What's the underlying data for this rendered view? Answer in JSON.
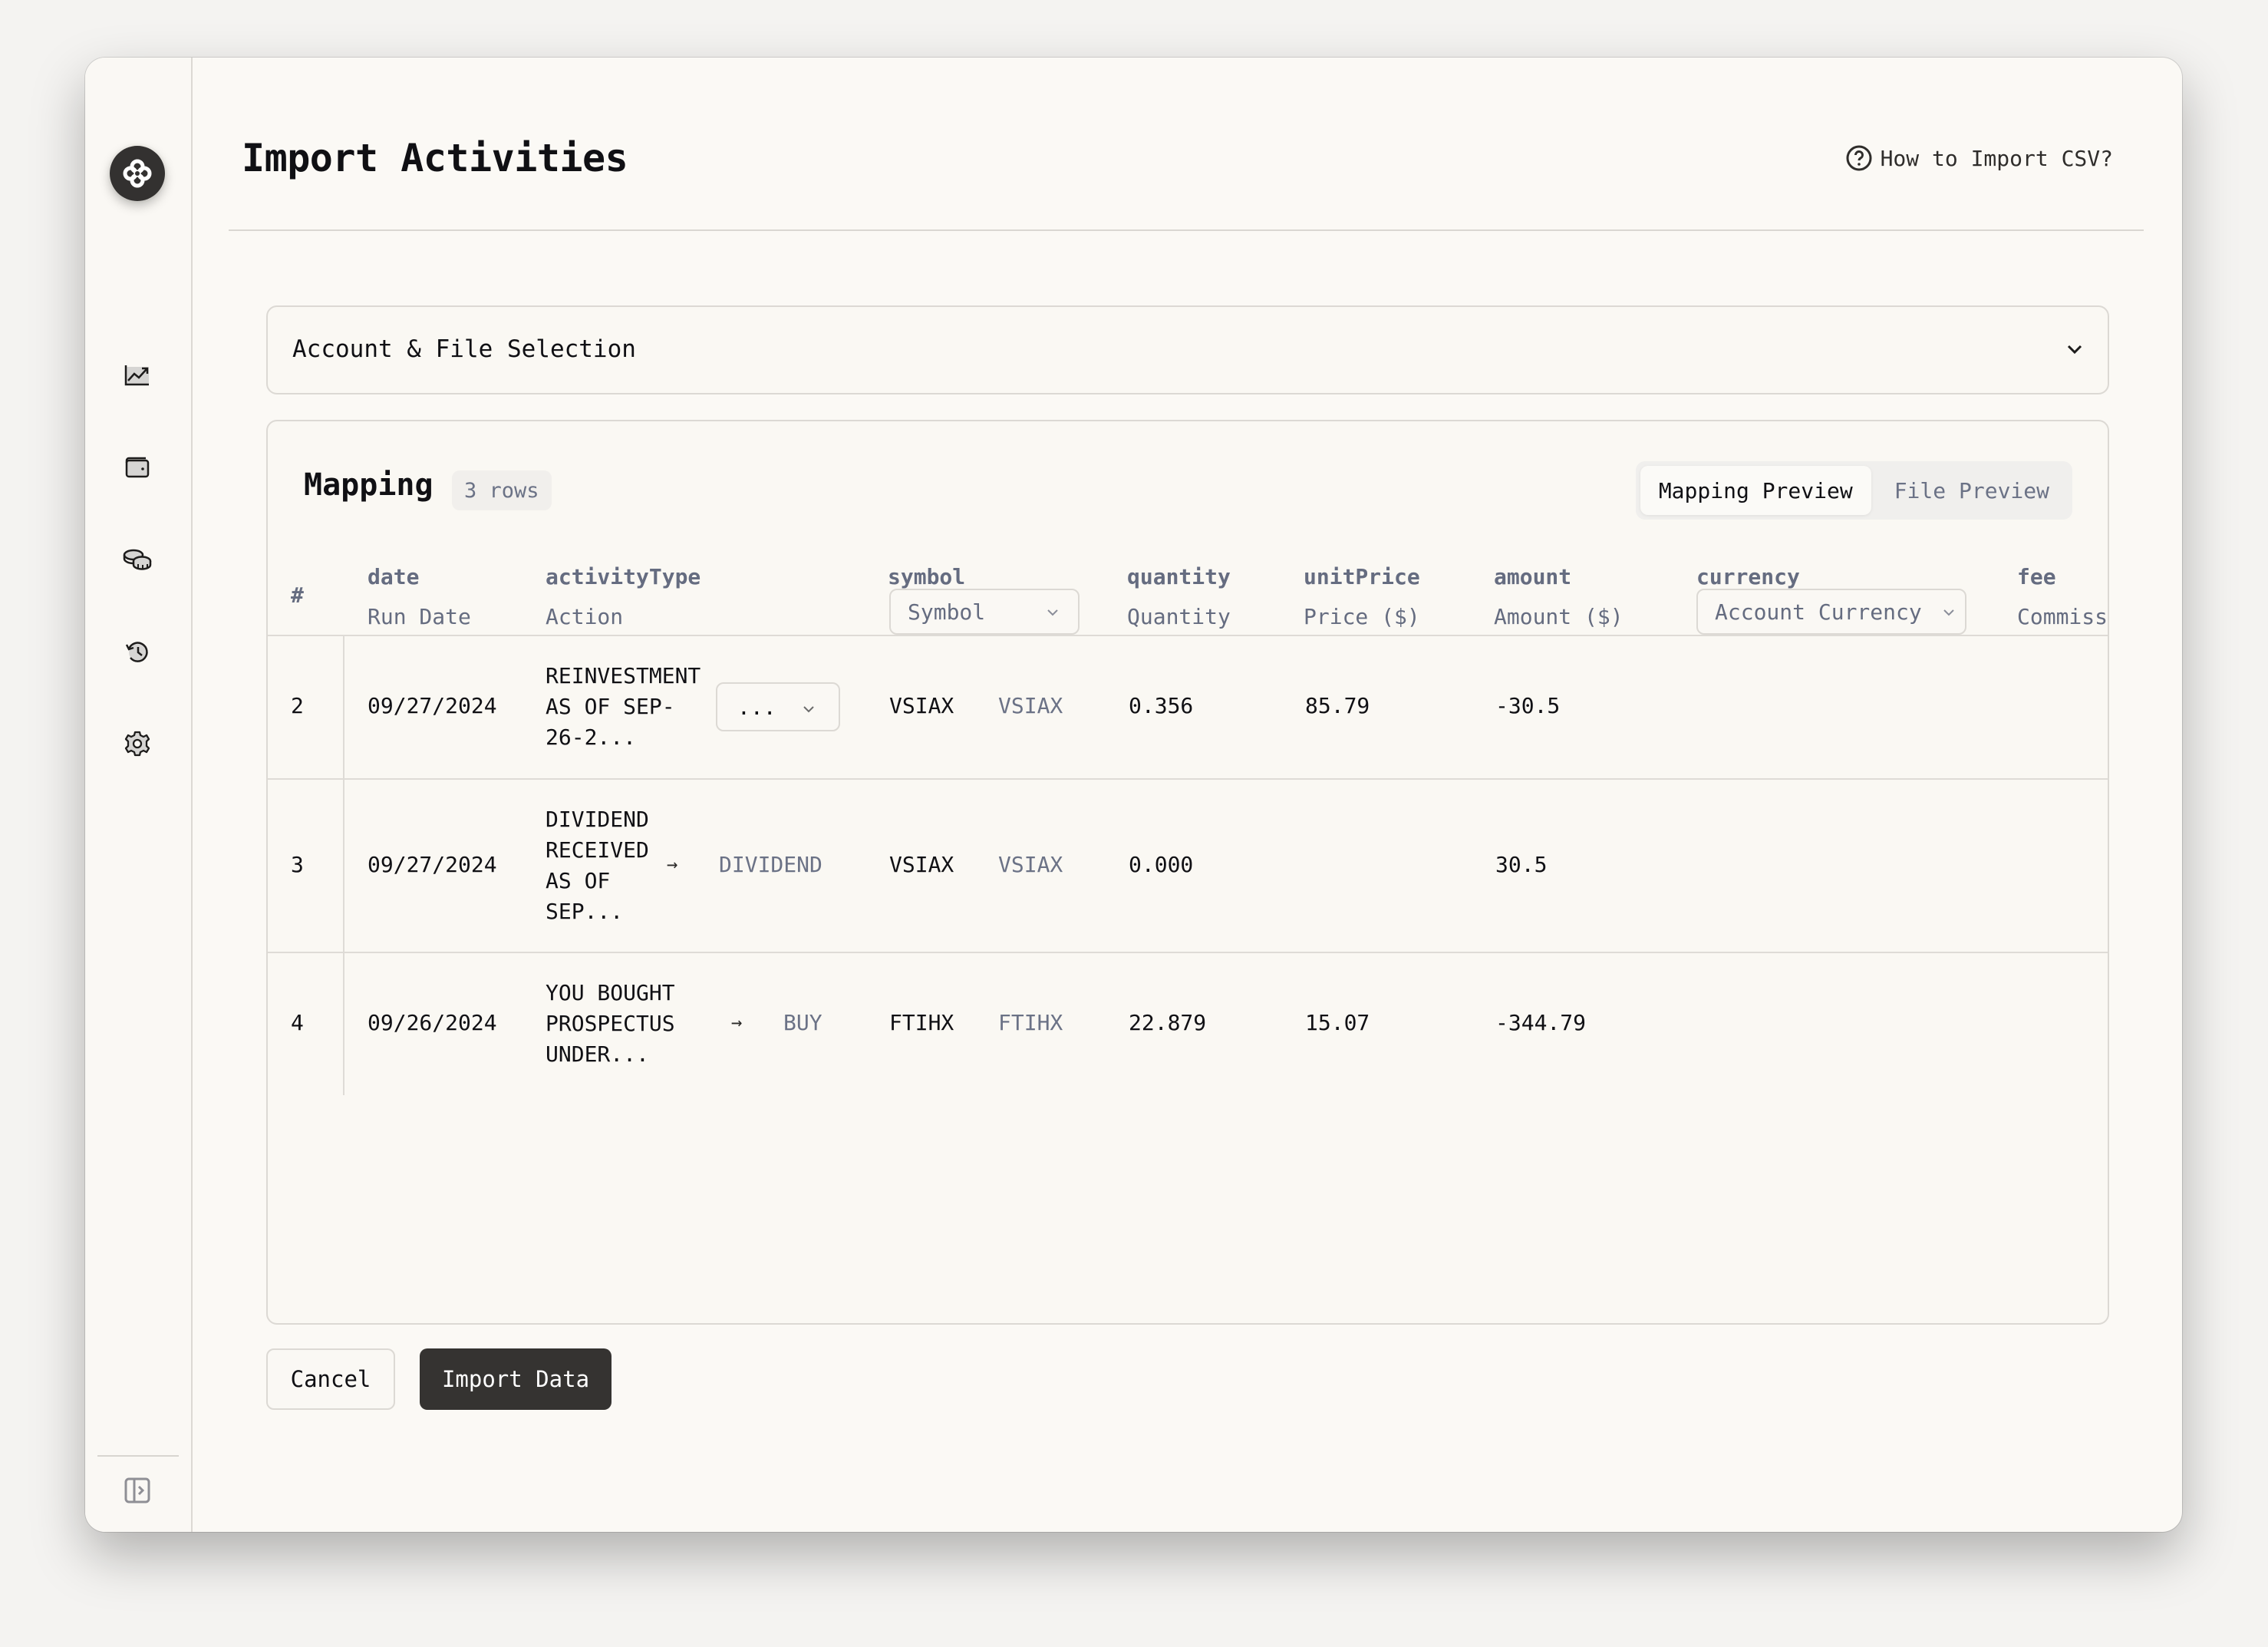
{
  "window": {
    "traffic_lights": [
      "close",
      "minimize",
      "zoom"
    ]
  },
  "sidebar": {
    "logo": "logo-icon",
    "items": [
      {
        "id": "dashboard",
        "icon": "chart-line-icon"
      },
      {
        "id": "accounts",
        "icon": "wallet-icon"
      },
      {
        "id": "holdings",
        "icon": "coins-icon"
      },
      {
        "id": "activities",
        "icon": "history-icon"
      },
      {
        "id": "settings",
        "icon": "gear-icon"
      }
    ],
    "collapse_icon": "sidebar-expand-icon"
  },
  "header": {
    "title": "Import Activities",
    "help_link": "How to Import CSV?"
  },
  "account_section": {
    "title": "Account & File Selection"
  },
  "mapping": {
    "title": "Mapping",
    "rows_badge": "3 rows",
    "tabs": [
      {
        "label": "Mapping Preview",
        "active": true
      },
      {
        "label": "File Preview",
        "active": false
      }
    ],
    "columns": {
      "index": "#",
      "date": {
        "field": "date",
        "source": "Run Date"
      },
      "activityType": {
        "field": "activityType",
        "source": "Action"
      },
      "symbol": {
        "field": "symbol",
        "source": "Symbol"
      },
      "quantity": {
        "field": "quantity",
        "source": "Quantity"
      },
      "unitPrice": {
        "field": "unitPrice",
        "source": "Price ($)"
      },
      "amount": {
        "field": "amount",
        "source": "Amount ($)"
      },
      "currency": {
        "field": "currency",
        "source": "Account Currency"
      },
      "fee": {
        "field": "fee",
        "source": "Commiss"
      }
    },
    "rows": [
      {
        "index": "2",
        "date": "09/27/2024",
        "action": "REINVESTMENT\nAS OF SEP-\n26-2...",
        "action_status": "unmapped",
        "mapped_type": "...",
        "symbol_raw": "VSIAX",
        "symbol_mapped": "VSIAX",
        "quantity": "0.356",
        "unit_price": "85.79",
        "amount": "-30.5"
      },
      {
        "index": "3",
        "date": "09/27/2024",
        "action": "DIVIDEND\nRECEIVED\nAS OF\nSEP...",
        "action_status": "mapped",
        "arrow": "→",
        "mapped_type": "DIVIDEND",
        "symbol_raw": "VSIAX",
        "symbol_mapped": "VSIAX",
        "quantity": "0.000",
        "unit_price": "",
        "amount": "30.5"
      },
      {
        "index": "4",
        "date": "09/26/2024",
        "action": "YOU BOUGHT\nPROSPECTUS\nUNDER...",
        "action_status": "mapped",
        "arrow": "→",
        "mapped_type": "BUY",
        "symbol_raw": "FTIHX",
        "symbol_mapped": "FTIHX",
        "quantity": "22.879",
        "unit_price": "15.07",
        "amount": "-344.79"
      }
    ]
  },
  "actions": {
    "cancel": "Cancel",
    "import": "Import Data"
  },
  "colors": {
    "background": "#fbf9f5",
    "primary_button": "#353331",
    "error_text": "#d9534f",
    "muted_text": "#6b7286"
  }
}
